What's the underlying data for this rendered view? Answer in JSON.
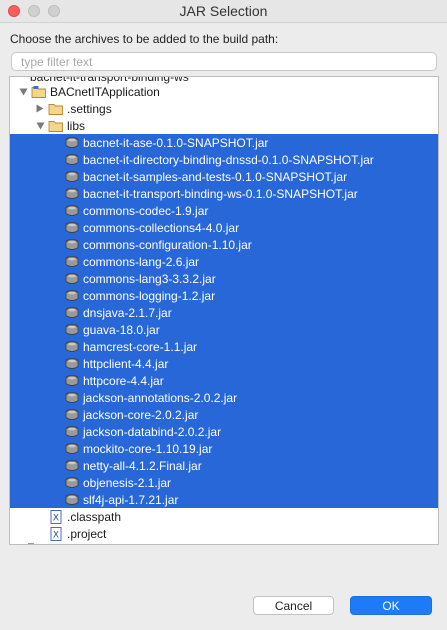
{
  "window": {
    "title": "JAR Selection"
  },
  "dialog": {
    "prompt": "Choose the archives to be added to the build path:",
    "filter_placeholder": "type filter text",
    "buttons": {
      "cancel": "Cancel",
      "ok": "OK"
    }
  },
  "tree": {
    "clipped_label": "bacnet-it-transport-binding-ws",
    "project": "BACnetITApplication",
    "settings_folder": ".settings",
    "libs_folder": "libs",
    "jars": [
      "bacnet-it-ase-0.1.0-SNAPSHOT.jar",
      "bacnet-it-directory-binding-dnssd-0.1.0-SNAPSHOT.jar",
      "bacnet-it-samples-and-tests-0.1.0-SNAPSHOT.jar",
      "bacnet-it-transport-binding-ws-0.1.0-SNAPSHOT.jar",
      "commons-codec-1.9.jar",
      "commons-collections4-4.0.jar",
      "commons-configuration-1.10.jar",
      "commons-lang-2.6.jar",
      "commons-lang3-3.3.2.jar",
      "commons-logging-1.2.jar",
      "dnsjava-2.1.7.jar",
      "guava-18.0.jar",
      "hamcrest-core-1.1.jar",
      "httpclient-4.4.jar",
      "httpcore-4.4.jar",
      "jackson-annotations-2.0.2.jar",
      "jackson-core-2.0.2.jar",
      "jackson-databind-2.0.2.jar",
      "mockito-core-1.10.19.jar",
      "netty-all-4.1.2.Final.jar",
      "objenesis-2.1.jar",
      "slf4j-api-1.7.21.jar"
    ],
    "files": [
      ".classpath",
      ".project"
    ]
  },
  "icons": {
    "project": "project-folder-icon",
    "folder": "folder-icon",
    "jar": "jar-icon",
    "file": "x-file-icon"
  },
  "colors": {
    "selection": "#2767d8",
    "ok_button": "#1d7bf7",
    "close_light": "#fc605c"
  }
}
